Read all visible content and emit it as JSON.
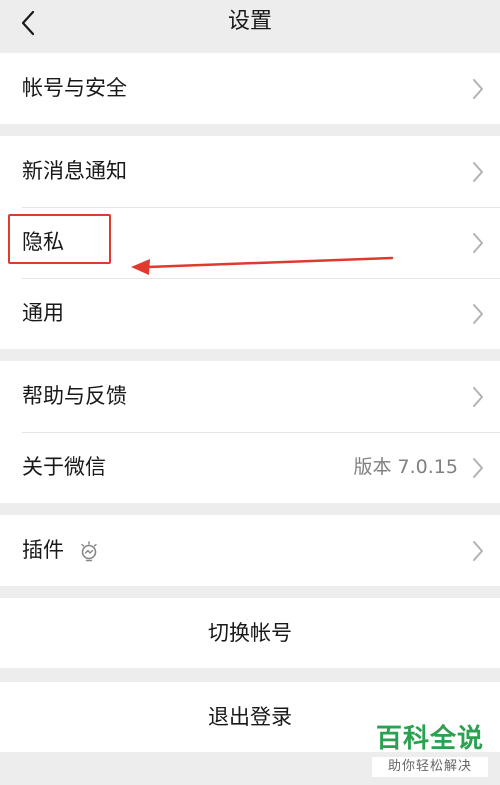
{
  "nav": {
    "title": "设置",
    "back_icon": "chevron-left-icon"
  },
  "groups": {
    "account": {
      "items": [
        {
          "label": "帐号与安全",
          "icon": "chevron-right-icon"
        }
      ]
    },
    "general": {
      "items": [
        {
          "label": "新消息通知",
          "icon": "chevron-right-icon"
        },
        {
          "label": "隐私",
          "icon": "chevron-right-icon"
        },
        {
          "label": "通用",
          "icon": "chevron-right-icon"
        }
      ]
    },
    "about": {
      "items": [
        {
          "label": "帮助与反馈",
          "icon": "chevron-right-icon"
        },
        {
          "label": "关于微信",
          "value": "版本 7.0.15",
          "icon": "chevron-right-icon"
        }
      ]
    },
    "plugins": {
      "items": [
        {
          "label": "插件",
          "icon": "chevron-right-icon",
          "badge_icon": "plugin-sparkle-icon"
        }
      ]
    }
  },
  "actions": {
    "switch_account": "切换帐号",
    "logout": "退出登录"
  },
  "annotation": {
    "color": "#e03a2f"
  },
  "watermark": {
    "brand": "百科全说",
    "tagline": "助你轻松解决",
    "color": "#2aa150"
  }
}
